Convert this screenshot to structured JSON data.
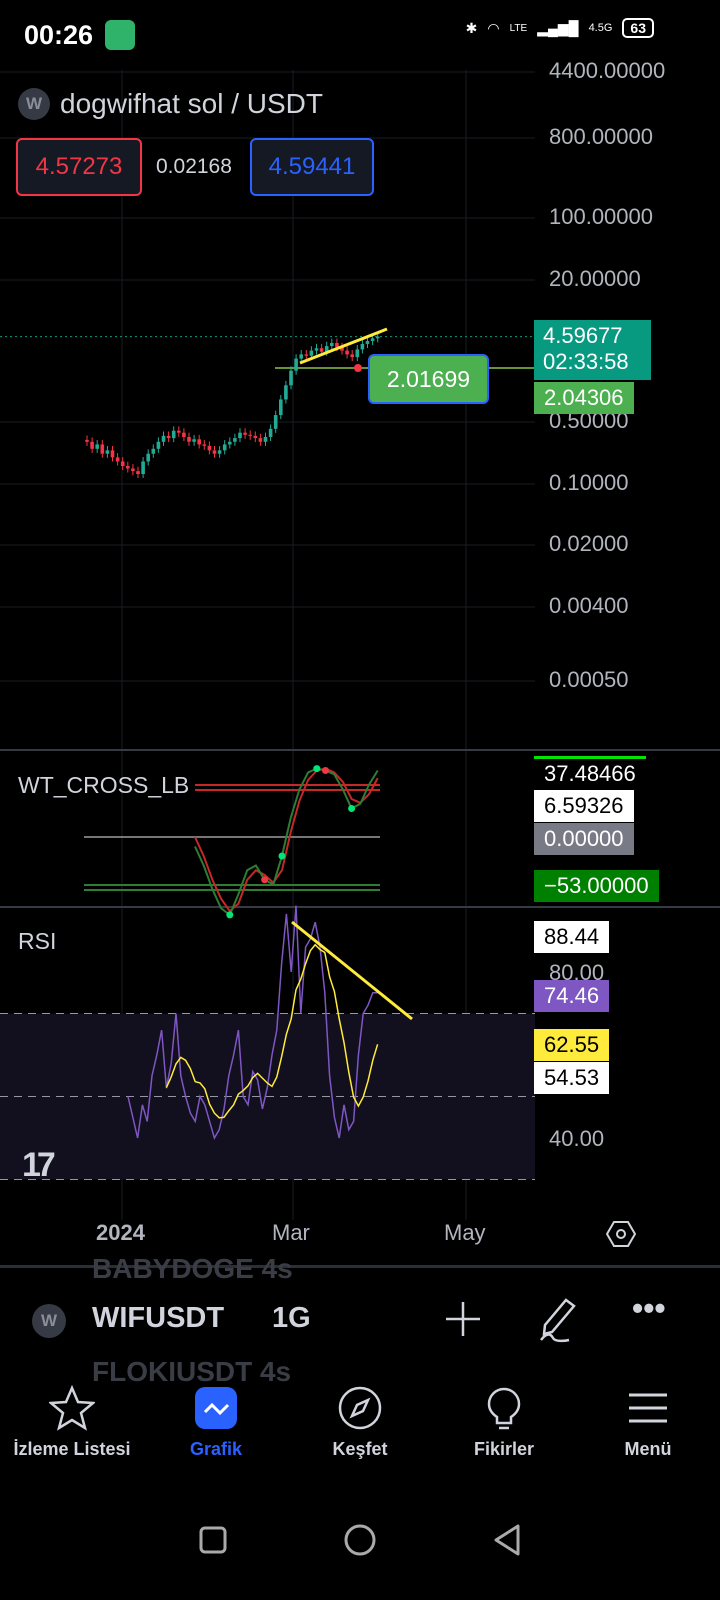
{
  "status_bar": {
    "time": "00:26",
    "network": "4.5G",
    "battery": "63"
  },
  "symbol": {
    "title": "dogwifhat sol / USDT",
    "logo_letter": "W",
    "bid": "4.57273",
    "spread": "0.02168",
    "ask": "4.59441"
  },
  "price_axis": [
    "4400.00000",
    "800.00000",
    "100.00000",
    "20.00000",
    "0.50000",
    "0.10000",
    "0.02000",
    "0.00400",
    "0.00050"
  ],
  "price_tags": {
    "last": "4.59677",
    "countdown": "02:33:58",
    "line": "2.04306",
    "label": "2.01699"
  },
  "wt": {
    "name": "WT_CROSS_LB",
    "tags": [
      "37.48466",
      "6.59326",
      "0.00000",
      "−53.00000"
    ]
  },
  "rsi": {
    "name": "RSI",
    "axis": [
      "80.00",
      "40.00"
    ],
    "tags": [
      "88.44",
      "74.46",
      "62.55",
      "54.53"
    ]
  },
  "time_axis": [
    "2024",
    "Mar",
    "May"
  ],
  "toolbar": {
    "ghost_above": "BABYDOGE  4s",
    "symbol": "WIFUSDT",
    "interval": "1G",
    "ghost_below": "FLOKIUSDT  4s"
  },
  "nav": [
    {
      "label": "İzleme Listesi"
    },
    {
      "label": "Grafik"
    },
    {
      "label": "Keşfet"
    },
    {
      "label": "Fikirler"
    },
    {
      "label": "Menü"
    }
  ],
  "colors": {
    "up": "#22ab94",
    "down": "#f23645",
    "rsi": "#7e57c2",
    "signal": "#ffeb3b",
    "accent": "#2962ff"
  },
  "chart_data": {
    "type": "candlestick",
    "scale": "log",
    "closes": [
      0.3,
      0.25,
      0.28,
      0.22,
      0.24,
      0.2,
      0.18,
      0.16,
      0.15,
      0.14,
      0.13,
      0.18,
      0.22,
      0.25,
      0.3,
      0.35,
      0.33,
      0.4,
      0.38,
      0.34,
      0.3,
      0.32,
      0.28,
      0.27,
      0.24,
      0.22,
      0.24,
      0.28,
      0.3,
      0.33,
      0.38,
      0.36,
      0.35,
      0.33,
      0.3,
      0.34,
      0.42,
      0.6,
      0.9,
      1.3,
      1.9,
      2.6,
      2.9,
      2.8,
      3.2,
      3.4,
      3.1,
      3.6,
      3.9,
      3.5,
      3.2,
      2.9,
      2.7,
      3.3,
      3.8,
      4.1,
      4.4,
      4.6
    ],
    "rsi": [
      50,
      45,
      40,
      48,
      44,
      55,
      60,
      66,
      52,
      58,
      70,
      55,
      50,
      46,
      44,
      50,
      48,
      44,
      40,
      42,
      47,
      55,
      60,
      66,
      50,
      48,
      56,
      54,
      47,
      52,
      60,
      66,
      82,
      94,
      80,
      96,
      70,
      86,
      88,
      92,
      86,
      75,
      55,
      45,
      40,
      48,
      42,
      44,
      60,
      70,
      72,
      75,
      75
    ],
    "wt1": [
      -10,
      -30,
      -55,
      -75,
      -82,
      -60,
      -35,
      -30,
      -45,
      -50,
      -20,
      20,
      50,
      68,
      72,
      70,
      66,
      50,
      30,
      35,
      55,
      70
    ],
    "wt2": [
      0,
      -20,
      -45,
      -65,
      -78,
      -70,
      -45,
      -35,
      -40,
      -48,
      -35,
      5,
      38,
      60,
      70,
      72,
      68,
      58,
      40,
      36,
      45,
      62
    ]
  }
}
